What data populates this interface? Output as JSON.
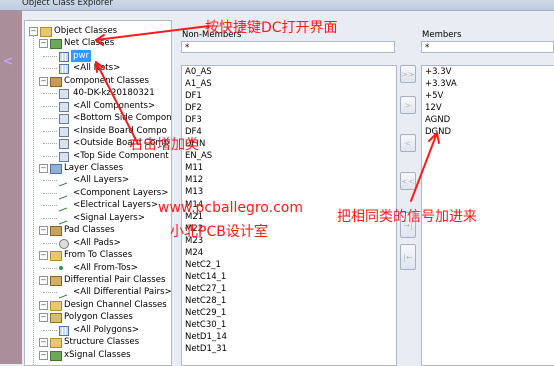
{
  "window": {
    "title": "Object Class Explorer"
  },
  "tree": {
    "root": "Object Classes",
    "nodes": [
      {
        "label": "Net Classes",
        "level": 1,
        "icon": "net-folder-icon"
      },
      {
        "label": "pwr",
        "level": 2,
        "icon": "net-class-icon",
        "selected": true
      },
      {
        "label": "<All Nets>",
        "level": 2,
        "icon": "net-class-icon"
      },
      {
        "label": "Component Classes",
        "level": 1,
        "icon": "component-folder-icon"
      },
      {
        "label": "40-DK-kz20180321",
        "level": 2,
        "icon": "component-class-icon"
      },
      {
        "label": "<All Components>",
        "level": 2,
        "icon": "component-class-icon"
      },
      {
        "label": "<Bottom Side Compon",
        "level": 2,
        "icon": "component-class-icon"
      },
      {
        "label": "<Inside Board Compo",
        "level": 2,
        "icon": "component-class-icon"
      },
      {
        "label": "<Outside Board Comp",
        "level": 2,
        "icon": "component-class-icon"
      },
      {
        "label": "<Top Side Component",
        "level": 2,
        "icon": "component-class-icon"
      },
      {
        "label": "Layer Classes",
        "level": 1,
        "icon": "layer-folder-icon"
      },
      {
        "label": "<All Layers>",
        "level": 2,
        "icon": "layer-class-icon"
      },
      {
        "label": "<Component Layers>",
        "level": 2,
        "icon": "layer-class-icon"
      },
      {
        "label": "<Electrical Layers>",
        "level": 2,
        "icon": "layer-class-icon"
      },
      {
        "label": "<Signal Layers>",
        "level": 2,
        "icon": "layer-class-icon"
      },
      {
        "label": "Pad Classes",
        "level": 1,
        "icon": "pad-folder-icon"
      },
      {
        "label": "<All Pads>",
        "level": 2,
        "icon": "pad-class-icon"
      },
      {
        "label": "From To Classes",
        "level": 1,
        "icon": "fromto-folder-icon"
      },
      {
        "label": "<All From-Tos>",
        "level": 2,
        "icon": "fromto-class-icon"
      },
      {
        "label": "Differential Pair Classes",
        "level": 1,
        "icon": "diffpair-folder-icon"
      },
      {
        "label": "<All Differential Pairs>",
        "level": 2,
        "icon": "diffpair-class-icon"
      },
      {
        "label": "Design Channel Classes",
        "level": 1,
        "icon": "channel-folder-icon"
      },
      {
        "label": "Polygon Classes",
        "level": 1,
        "icon": "polygon-folder-icon"
      },
      {
        "label": "<All Polygons>",
        "level": 2,
        "icon": "polygon-class-icon"
      },
      {
        "label": "Structure Classes",
        "level": 1,
        "icon": "structure-folder-icon"
      },
      {
        "label": "xSignal Classes",
        "level": 1,
        "icon": "xsignal-folder-icon"
      }
    ]
  },
  "non_members": {
    "header": "Non-Members",
    "filter": "*",
    "items": [
      "A0_AS",
      "A1_AS",
      "DF1",
      "DF2",
      "DF3",
      "DF4",
      "DFIN",
      "EN_AS",
      "M11",
      "M12",
      "M13",
      "M14",
      "M21",
      "M22",
      "M23",
      "M24",
      "NetC2_1",
      "NetC14_1",
      "NetC27_1",
      "NetC28_1",
      "NetC29_1",
      "NetC30_1",
      "NetD1_14",
      "NetD1_31"
    ]
  },
  "members": {
    "header": "Members",
    "filter": "*",
    "items": [
      "+3.3V",
      "+3.3VA",
      "+5V",
      "12V",
      "AGND",
      "DGND"
    ]
  },
  "transfer_buttons": [
    ">>",
    ">",
    "<",
    "<<",
    "→|",
    "|←"
  ],
  "annotations": {
    "shortcut_hint": "按快捷键DC打开界面",
    "right_click_hint": "右击增加类",
    "add_signals_hint": "把相同类的信号加进来",
    "watermark_url": "www.pcballegro.com",
    "watermark_name": "小北PCB设计室"
  },
  "colors": {
    "selection": "#3399ff",
    "annotation": "#ff1a1a"
  }
}
